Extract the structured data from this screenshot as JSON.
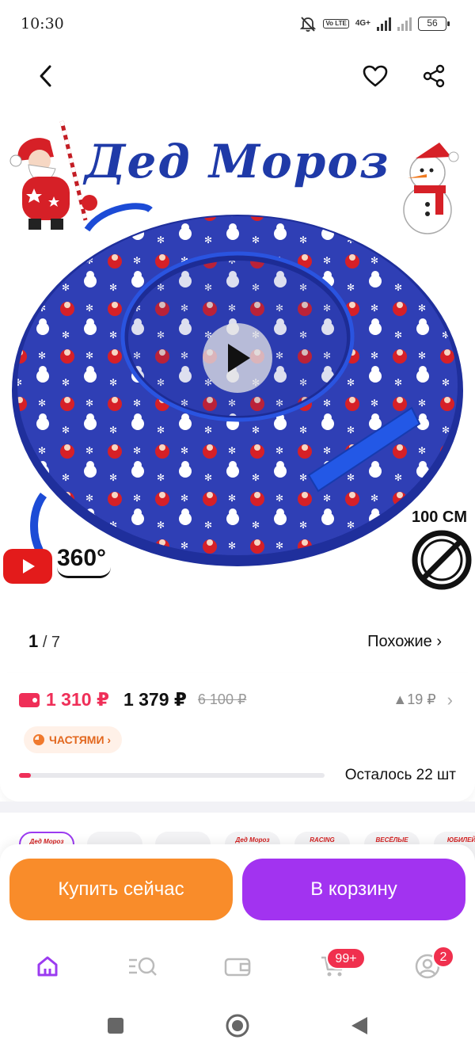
{
  "status_bar": {
    "time": "10:30",
    "network_label": "4G+",
    "volte_label": "Vo LTE",
    "battery": "56",
    "icons": [
      "mute-icon",
      "signal-icon",
      "battery-icon"
    ]
  },
  "top_nav": {
    "back_icon": "chevron-left-icon",
    "favorite_icon": "heart-icon",
    "share_icon": "share-icon"
  },
  "hero": {
    "title": "Дед Мороз",
    "diameter_label": "100 CM",
    "badge_360": "360°",
    "play_icon": "play-icon",
    "youtube_icon": "youtube-icon"
  },
  "gallery": {
    "current": "1",
    "separator_total": "/ 7",
    "similar_label": "Похожие ›"
  },
  "price": {
    "wallet_price": "1 310 ₽",
    "price": "1 379 ₽",
    "old_price": "6 100 ₽",
    "price_change": "▲19 ₽",
    "chevron": "›",
    "installment_label": "ЧАСТЯМИ ›",
    "accent_color": "#ef2f58"
  },
  "stock": {
    "remaining_text": "Осталось 22 шт",
    "remaining_fraction": 0.04
  },
  "variants": {
    "labels": [
      "Дед Мороз",
      "",
      "",
      "Дед Мороз",
      "RACING",
      "ВЕСЁЛЫЕ ЗИМНИЕ ЗАБАВЫ",
      "ЮБИЛЕЙ"
    ]
  },
  "actions": {
    "buy_now": "Купить сейчас",
    "add_to_cart": "В корзину",
    "buy_color": "#f98c2a",
    "cart_color": "#a233f0"
  },
  "tab_bar": {
    "items": [
      {
        "icon": "home-icon",
        "active": true
      },
      {
        "icon": "catalog-search-icon",
        "active": false
      },
      {
        "icon": "wallet-icon",
        "active": false
      },
      {
        "icon": "cart-icon",
        "active": false,
        "badge": "99+"
      },
      {
        "icon": "profile-icon",
        "active": false,
        "badge": "2"
      }
    ],
    "active_color": "#9b3bf0"
  },
  "system_nav": {
    "icons": [
      "recents-icon",
      "home-circle-icon",
      "back-triangle-icon"
    ]
  }
}
